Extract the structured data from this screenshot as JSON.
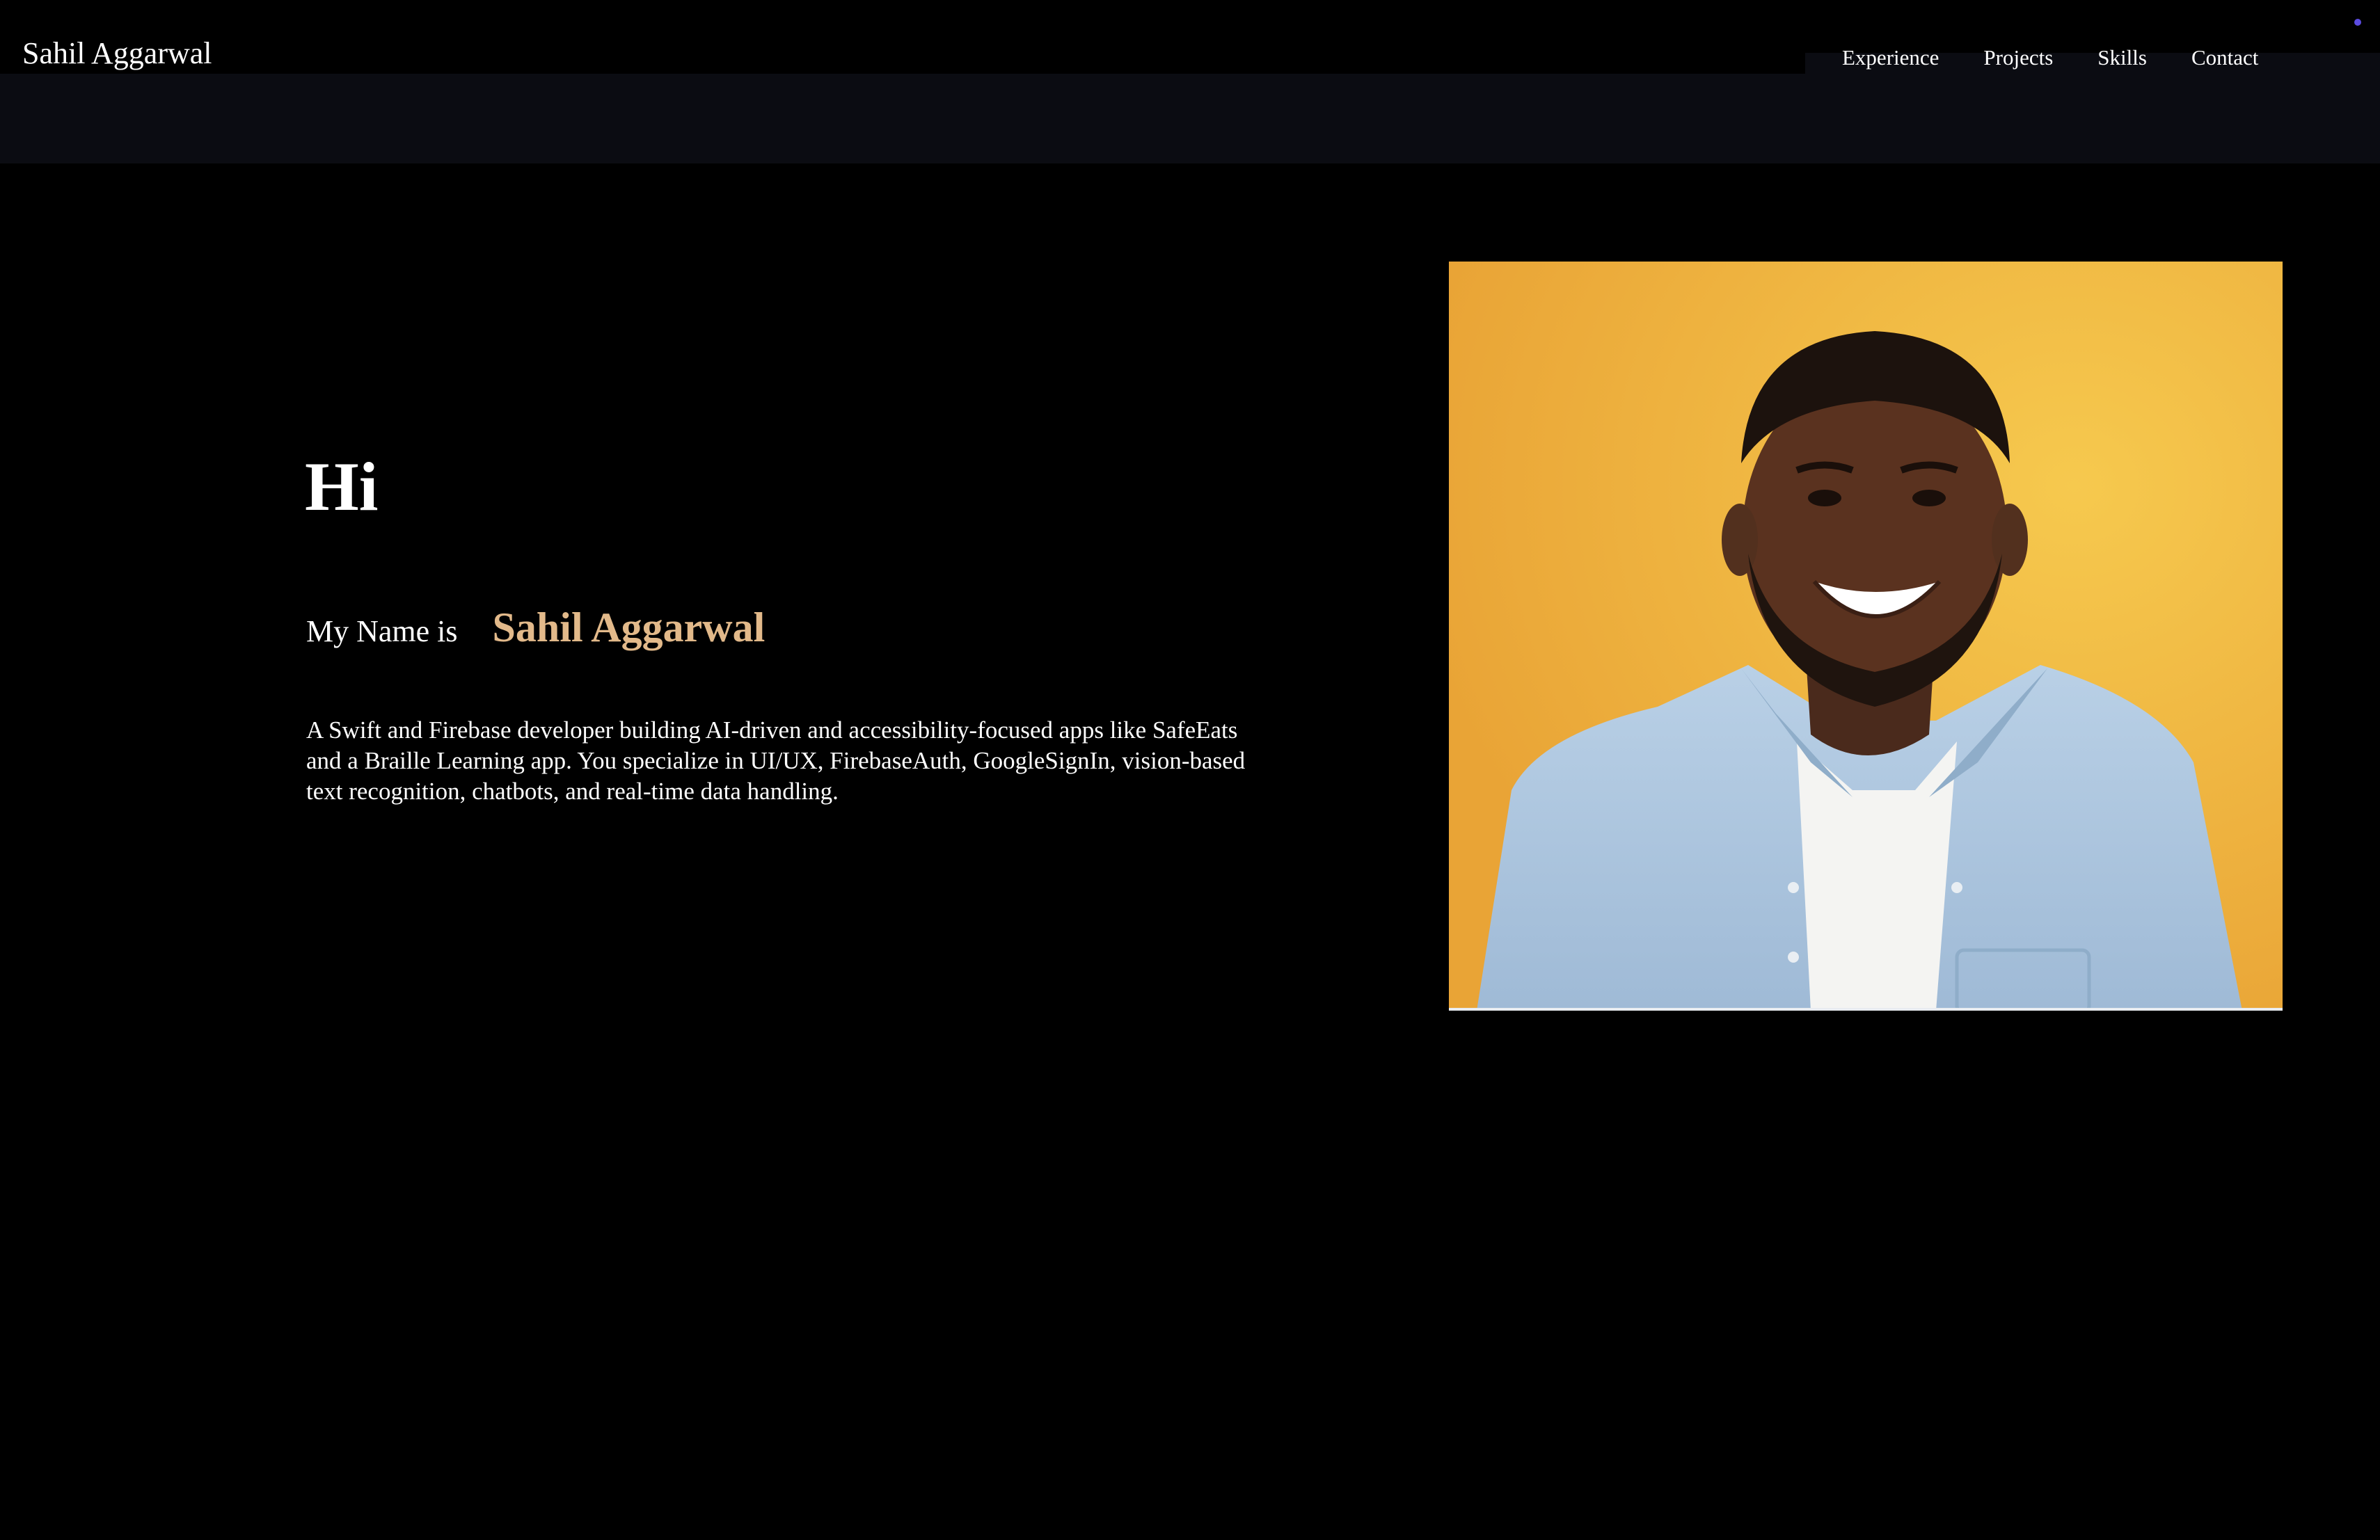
{
  "nav": {
    "brand": "Sahil Aggarwal",
    "links": [
      "Experience",
      "Projects",
      "Skills",
      "Contact"
    ]
  },
  "hero": {
    "greeting": "Hi",
    "name_prefix": "My Name is",
    "name": "Sahil Aggarwal",
    "bio": "A Swift and Firebase developer building AI-driven and accessibility-focused apps like SafeEats and a Braille Learning app. You specialize in UI/UX, FirebaseAuth, GoogleSignIn, vision-based text recognition, chatbots, and real-time data handling."
  },
  "profile_photo": {
    "background_color": "#eeb23d",
    "icon": "profile-portrait"
  },
  "colors": {
    "background": "#000000",
    "navbar": "#0b0c12",
    "accent": "#e2b98a",
    "status_dot": "#5b4be0"
  }
}
